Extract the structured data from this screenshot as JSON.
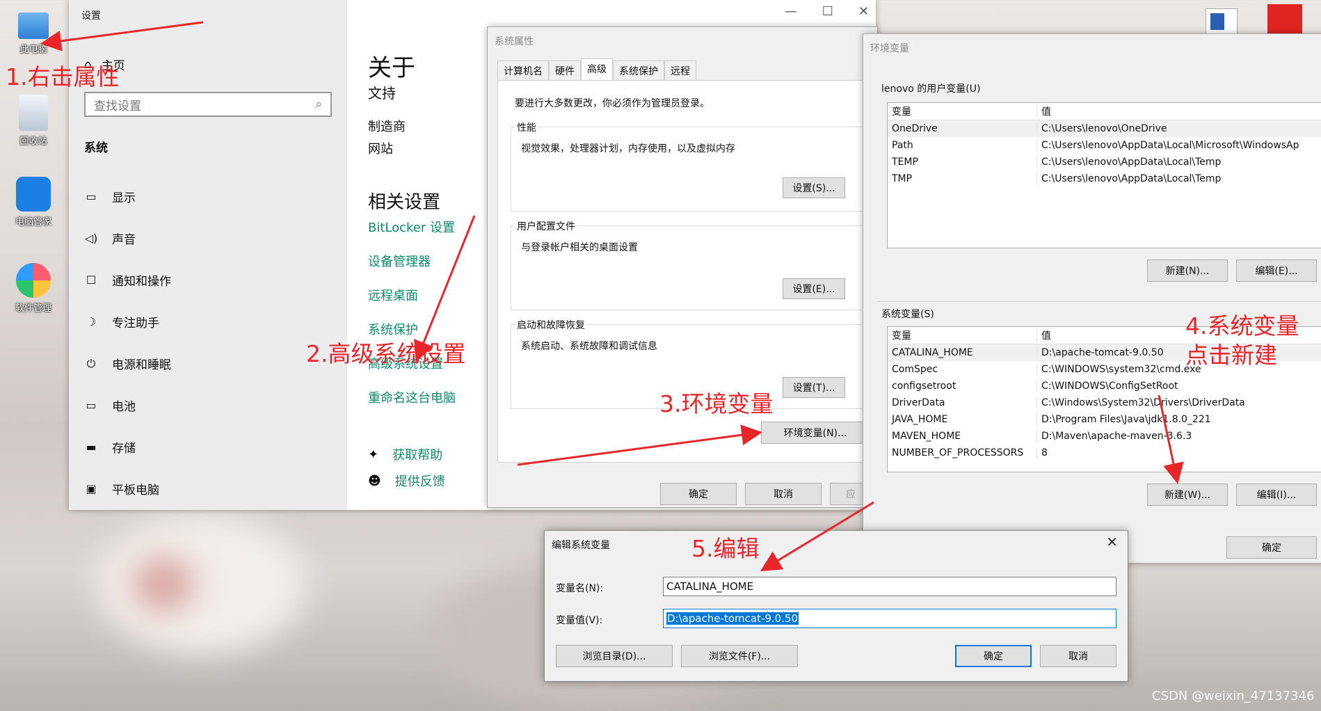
{
  "desktop": {
    "icons": [
      {
        "label": "此电脑",
        "icon": "computer-icon"
      },
      {
        "label": "回收站",
        "icon": "recycle-bin-icon"
      },
      {
        "label": "电脑管家",
        "icon": "pc-manager-icon"
      },
      {
        "label": "软件管理",
        "icon": "software-manager-icon"
      }
    ],
    "watermark": "CSDN @weixin_47137346"
  },
  "settings": {
    "title": "设置",
    "controls": [
      "—",
      "☐",
      "✕"
    ],
    "home": "主页",
    "search_placeholder": "查找设置",
    "section": "系统",
    "nav": [
      {
        "label": "显示",
        "icon": "display-icon"
      },
      {
        "label": "声音",
        "icon": "sound-icon"
      },
      {
        "label": "通知和操作",
        "icon": "notification-icon"
      },
      {
        "label": "专注助手",
        "icon": "moon-icon"
      },
      {
        "label": "电源和睡眠",
        "icon": "power-icon"
      },
      {
        "label": "电池",
        "icon": "battery-icon"
      },
      {
        "label": "存储",
        "icon": "storage-icon"
      },
      {
        "label": "平板电脑",
        "icon": "tablet-icon"
      }
    ],
    "about_title": "关于",
    "about_sub": "文持",
    "maker": "制造商",
    "website": "网站",
    "related_title": "相关设置",
    "links": [
      "BitLocker 设置",
      "设备管理器",
      "远程桌面",
      "系统保护",
      "高级系统设置",
      "重命名这台电脑"
    ],
    "help": "获取帮助",
    "feedback": "提供反馈"
  },
  "system_properties": {
    "title": "系统属性",
    "tabs": [
      "计算机名",
      "硬件",
      "高级",
      "系统保护",
      "远程"
    ],
    "note": "要进行大多数更改，你必须作为管理员登录。",
    "groups": [
      {
        "label": "性能",
        "desc": "视觉效果，处理器计划，内存使用，以及虚拟内存",
        "button": "设置(S)..."
      },
      {
        "label": "用户配置文件",
        "desc": "与登录帐户相关的桌面设置",
        "button": "设置(E)..."
      },
      {
        "label": "启动和故障恢复",
        "desc": "系统启动、系统故障和调试信息",
        "button": "设置(T)..."
      }
    ],
    "env_button": "环境变量(N)...",
    "ok": "确定",
    "cancel": "取消",
    "apply": "应"
  },
  "env_vars": {
    "title": "环境变量",
    "user_section": "lenovo 的用户变量(U)",
    "col_var": "变量",
    "col_val": "值",
    "user_vars": [
      {
        "name": "OneDrive",
        "value": "C:\\Users\\lenovo\\OneDrive"
      },
      {
        "name": "Path",
        "value": "C:\\Users\\lenovo\\AppData\\Local\\Microsoft\\WindowsAp"
      },
      {
        "name": "TEMP",
        "value": "C:\\Users\\lenovo\\AppData\\Local\\Temp"
      },
      {
        "name": "TMP",
        "value": "C:\\Users\\lenovo\\AppData\\Local\\Temp"
      }
    ],
    "user_new": "新建(N)...",
    "user_edit": "编辑(E)...",
    "sys_section": "系统变量(S)",
    "sys_vars": [
      {
        "name": "CATALINA_HOME",
        "value": "D:\\apache-tomcat-9.0.50"
      },
      {
        "name": "ComSpec",
        "value": "C:\\WINDOWS\\system32\\cmd.exe"
      },
      {
        "name": "configsetroot",
        "value": "C:\\WINDOWS\\ConfigSetRoot"
      },
      {
        "name": "DriverData",
        "value": "C:\\Windows\\System32\\Drivers\\DriverData"
      },
      {
        "name": "JAVA_HOME",
        "value": "D:\\Program Files\\Java\\jdk1.8.0_221"
      },
      {
        "name": "MAVEN_HOME",
        "value": "D:\\Maven\\apache-maven-3.6.3"
      },
      {
        "name": "NUMBER_OF_PROCESSORS",
        "value": "8"
      }
    ],
    "sys_new": "新建(W)...",
    "sys_edit": "编辑(I)...",
    "ok": "确定"
  },
  "edit_dialog": {
    "title": "编辑系统变量",
    "close": "✕",
    "name_label": "变量名(N):",
    "name_value": "CATALINA_HOME",
    "value_label": "变量值(V):",
    "value_value": "D:\\apache-tomcat-9.0.50",
    "browse_dir": "浏览目录(D)...",
    "browse_file": "浏览文件(F)...",
    "ok": "确定",
    "cancel": "取消"
  },
  "annotations": {
    "step1": "1.右击属性",
    "step2": "2.高级系统设置",
    "step3": "3.环境变量",
    "step4a": "4.系统变量",
    "step4b": "点击新建",
    "step5": "5.编辑",
    "color": "#e8262a"
  }
}
